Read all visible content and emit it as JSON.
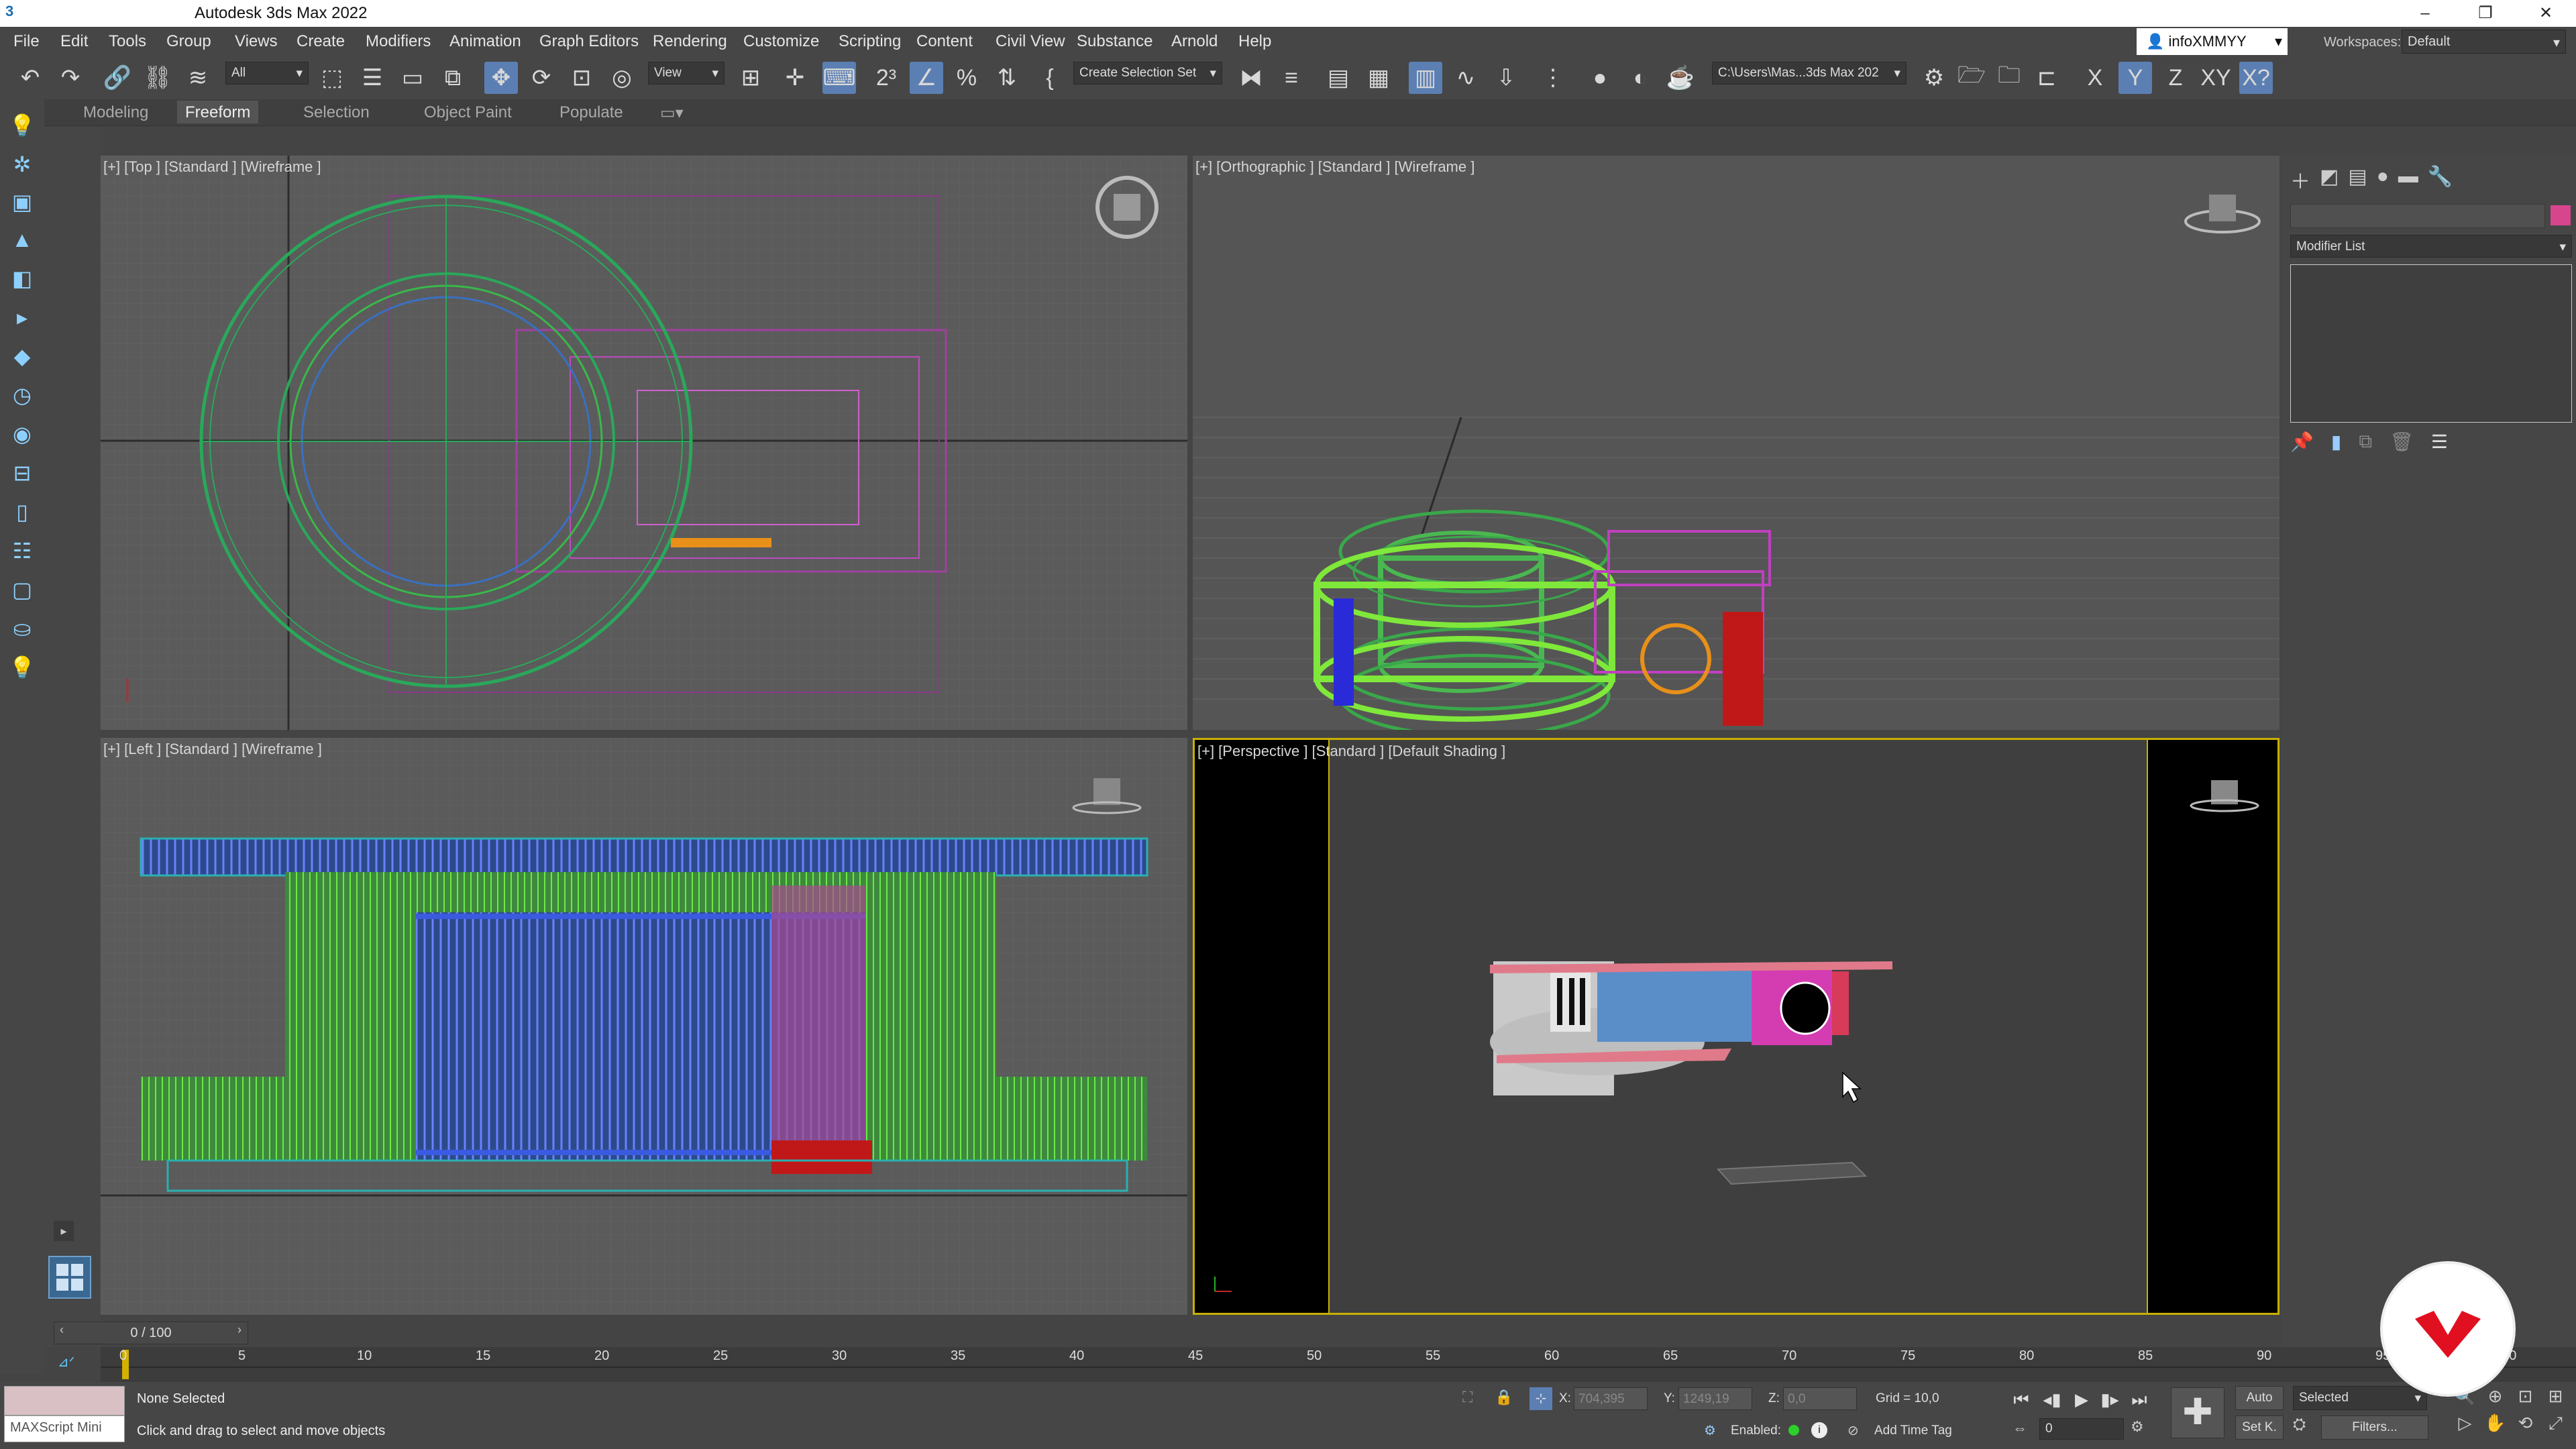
{
  "app": {
    "title": "Autodesk 3ds Max 2022",
    "logo": "3"
  },
  "window_controls": {
    "minimize": "–",
    "restore": "❐",
    "close": "✕"
  },
  "menu": [
    "File",
    "Edit",
    "Tools",
    "Group",
    "Views",
    "Create",
    "Modifiers",
    "Animation",
    "Graph Editors",
    "Rendering",
    "Customize",
    "Scripting",
    "Content",
    "Civil View",
    "Substance",
    "Arnold",
    "Help"
  ],
  "user": {
    "name": "infoXMMYY"
  },
  "workspace": {
    "label": "Workspaces:",
    "value": "Default"
  },
  "toolbar": {
    "selection_filter": "All",
    "ref_coord": "View",
    "named_selection": "Create Selection Set",
    "project_path": "C:\\Users\\Mas...3ds Max 202",
    "axis_x": "X",
    "axis_y": "Y",
    "axis_z": "Z",
    "axis_xy": "XY"
  },
  "ribbon_tabs": [
    "Modeling",
    "Freeform",
    "Selection",
    "Object Paint",
    "Populate"
  ],
  "ribbon_active": "Freeform",
  "viewports": {
    "top": "[+] [Top ] [Standard ] [Wireframe ]",
    "ortho": "[+] [Orthographic ] [Standard ] [Wireframe ]",
    "left": "[+] [Left ] [Standard ] [Wireframe ]",
    "persp": "[+] [Perspective ] [Standard ] [Default Shading ]"
  },
  "command_panel": {
    "modifier_list": "Modifier List",
    "swatch_color": "#d7458d"
  },
  "time_slider": {
    "value": "0 / 100"
  },
  "timeline": {
    "ticks": [
      "0",
      "5",
      "10",
      "15",
      "20",
      "25",
      "30",
      "35",
      "40",
      "45",
      "50",
      "55",
      "60",
      "65",
      "70",
      "75",
      "80",
      "85",
      "90",
      "95",
      "100"
    ]
  },
  "status": {
    "maxscript": "MAXScript Mini",
    "selection": "None Selected",
    "prompt": "Click and drag to select and move objects",
    "x_label": "X:",
    "x_value": "704,395",
    "y_label": "Y:",
    "y_value": "1249,19",
    "z_label": "Z:",
    "z_value": "0,0",
    "grid": "Grid = 10,0",
    "enabled_label": "Enabled:",
    "add_time_tag": "Add Time Tag",
    "auto_key": "Auto",
    "set_key": "Set K.",
    "key_mode": "Selected",
    "filters": "Filters...",
    "frame": "0"
  }
}
